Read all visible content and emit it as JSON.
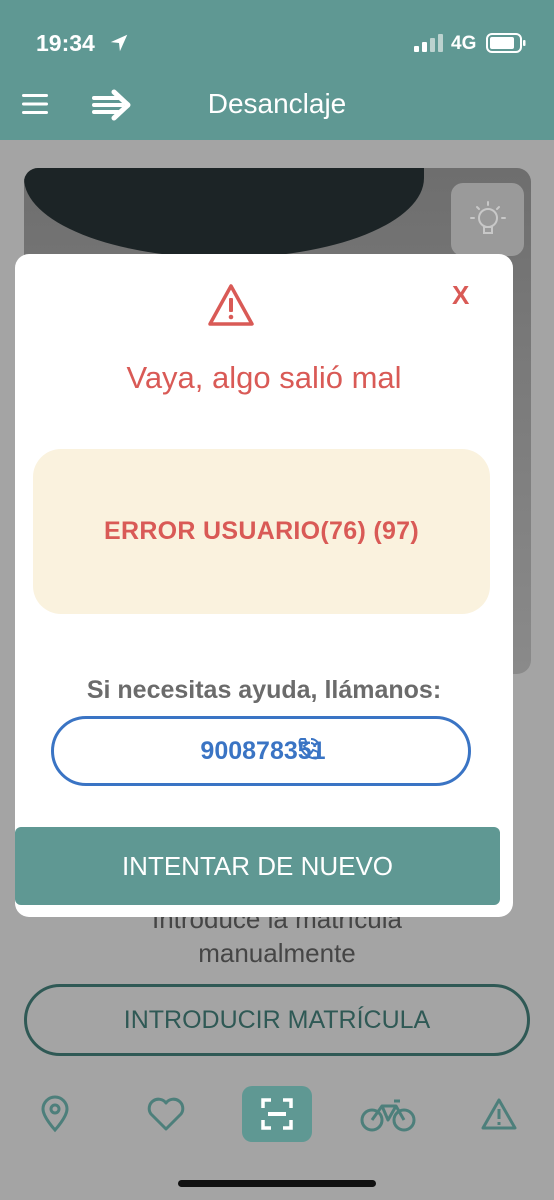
{
  "status_bar": {
    "time": "19:34",
    "network": "4G"
  },
  "app_bar": {
    "title": "Desanclaje",
    "menu_icon": "hamburger-icon",
    "logo_icon": "bike-share-logo-icon"
  },
  "background": {
    "flash_icon": "lightbulb-icon",
    "manual_text_line1": "Introduce la matrícula",
    "manual_text_line2": "manualmente",
    "manual_button": "INTRODUCIR MATRÍCULA"
  },
  "bottom_nav": {
    "items": [
      {
        "icon": "map-pin-icon"
      },
      {
        "icon": "heart-icon"
      },
      {
        "icon": "scan-icon",
        "active": true
      },
      {
        "icon": "bicycle-icon"
      },
      {
        "icon": "warning-icon"
      }
    ]
  },
  "modal": {
    "close_label": "X",
    "title": "Vaya, algo salió mal",
    "error_message": "ERROR USUARIO(76) (97)",
    "help_text": "Si necesitas ayuda, llámanos:",
    "phone_number": "900878351",
    "retry_button": "INTENTAR DE NUEVO"
  },
  "colors": {
    "brand": "#5f9893",
    "error": "#d95a56",
    "error_bg": "#faf2de",
    "link": "#3a74c4"
  }
}
